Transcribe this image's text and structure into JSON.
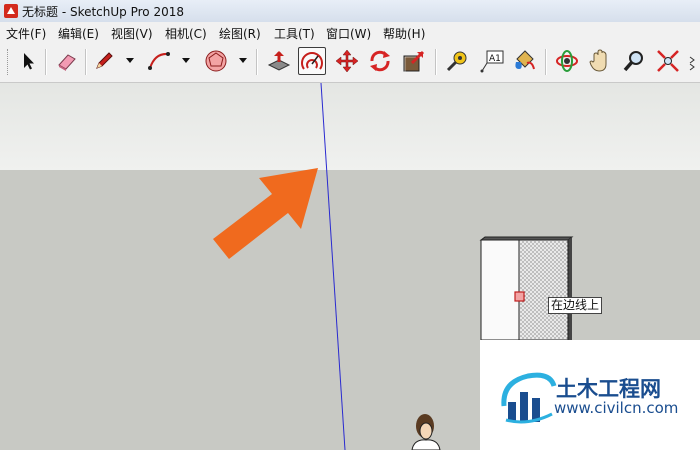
{
  "window": {
    "title": "无标题 - SketchUp Pro 2018"
  },
  "menu": [
    "文件(F)",
    "编辑(E)",
    "视图(V)",
    "相机(C)",
    "绘图(R)",
    "工具(T)",
    "窗口(W)",
    "帮助(H)"
  ],
  "toolbar": {
    "tools": [
      "select-tool",
      "eraser-tool",
      "line-tool",
      "arc-tool",
      "shape-tool",
      "push-pull-tool",
      "offset-tool",
      "move-tool",
      "rotate-tool",
      "scale-tool",
      "tape-measure-tool",
      "text-tool",
      "paint-bucket-tool",
      "orbit-tool",
      "pan-tool",
      "zoom-tool",
      "zoom-extents-tool"
    ],
    "active_tool": "offset-tool"
  },
  "viewport": {
    "tooltip": "在边线上",
    "annotation": "orange arrow pointing at the offset tool"
  },
  "watermark": {
    "brand": "土木工程网",
    "url": "www.civilcn.com"
  },
  "colors": {
    "annotation_arrow": "#f06a1e",
    "watermark_blue": "#1a4d8f",
    "axis_blue": "#2a2ad0"
  }
}
